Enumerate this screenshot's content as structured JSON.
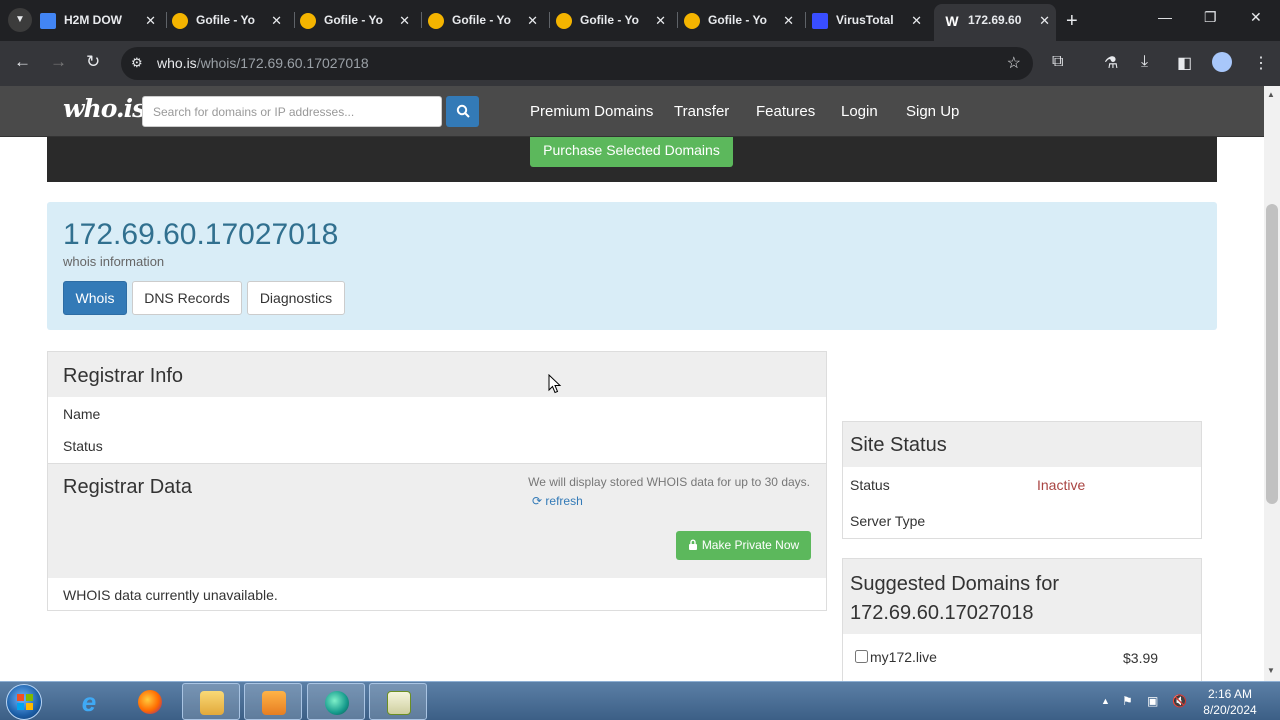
{
  "browser": {
    "tabs": [
      {
        "title": "H2M DOW",
        "icon": "docs-icon",
        "color": "#4285f4"
      },
      {
        "title": "Gofile - Yo",
        "icon": "gofile-icon",
        "color": "#f4b400"
      },
      {
        "title": "Gofile - Yo",
        "icon": "gofile-icon",
        "color": "#f4b400"
      },
      {
        "title": "Gofile - Yo",
        "icon": "gofile-icon",
        "color": "#f4b400"
      },
      {
        "title": "Gofile - Yo",
        "icon": "gofile-icon",
        "color": "#f4b400"
      },
      {
        "title": "Gofile - Yo",
        "icon": "gofile-icon",
        "color": "#f4b400"
      },
      {
        "title": "VirusTotal",
        "icon": "virustotal-icon",
        "color": "#394eff"
      },
      {
        "title": "172.69.60",
        "icon": "whois-w-icon",
        "color": "#ffffff"
      }
    ],
    "url_domain": "who.is",
    "url_path": "/whois/172.69.60.17027018"
  },
  "site": {
    "logo": "who.is",
    "search_placeholder": "Search for domains or IP addresses...",
    "nav": [
      "Premium Domains",
      "Transfer",
      "Features",
      "Login",
      "Sign Up"
    ],
    "purchase_label": "Purchase Selected Domains"
  },
  "ip_panel": {
    "title": "172.69.60.17027018",
    "subtitle": "whois information",
    "tabs": [
      "Whois",
      "DNS Records",
      "Diagnostics"
    ],
    "active_tab": "Whois"
  },
  "registrar": {
    "info_title": "Registrar Info",
    "rows": [
      "Name",
      "Status"
    ],
    "data_title": "Registrar Data",
    "note": "We will display stored WHOIS data for up to 30 days.",
    "refresh_label": "refresh",
    "private_label": "Make Private Now",
    "unavailable": "WHOIS data currently unavailable."
  },
  "site_status": {
    "title": "Site Status",
    "status_label": "Status",
    "status_value": "Inactive",
    "server_label": "Server Type"
  },
  "suggested": {
    "title": "Suggested Domains for 172.69.60.17027018",
    "items": [
      {
        "domain": "my172.live",
        "price": "$3.99"
      }
    ]
  },
  "taskbar": {
    "time": "2:16 AM",
    "date": "8/20/2024"
  },
  "colors": {
    "primary": "#337ab7",
    "success": "#5cb85c",
    "info_bg": "#d9edf7",
    "danger_text": "#a94442"
  }
}
